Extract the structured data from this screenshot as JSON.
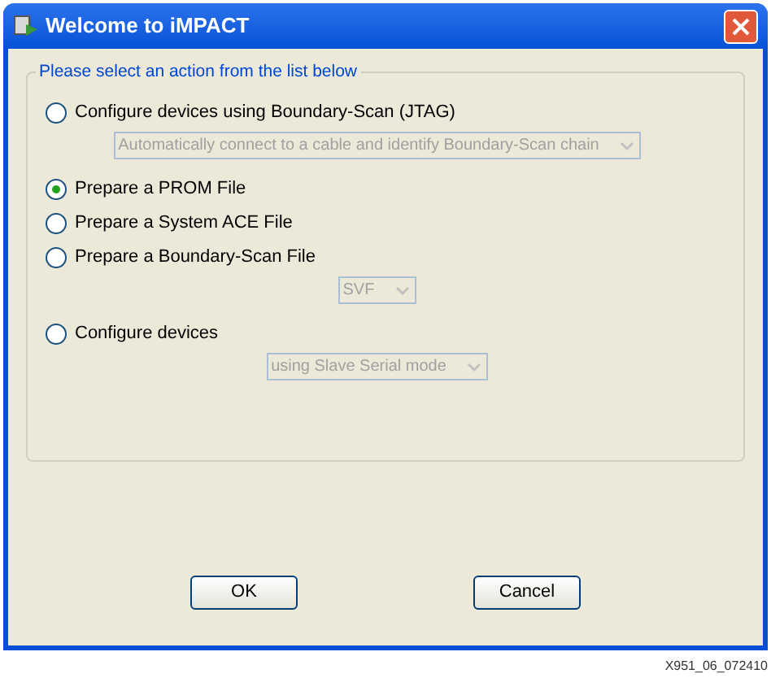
{
  "window": {
    "title": "Welcome to iMPACT"
  },
  "group": {
    "title": "Please select an action from the list below",
    "options": [
      {
        "label": "Configure devices using Boundary-Scan (JTAG)",
        "selected": false,
        "dropdown": {
          "value": "Automatically connect to a cable and identify Boundary-Scan chain",
          "disabled": true
        }
      },
      {
        "label": "Prepare a PROM File",
        "selected": true
      },
      {
        "label": "Prepare a System ACE File",
        "selected": false
      },
      {
        "label": "Prepare a Boundary-Scan File",
        "selected": false,
        "dropdown": {
          "value": "SVF",
          "disabled": true
        }
      },
      {
        "label": "Configure devices",
        "selected": false,
        "dropdown": {
          "value": "using Slave Serial mode",
          "disabled": true
        }
      }
    ]
  },
  "buttons": [
    "OK",
    "Cancel"
  ],
  "figure_id": "X951_06_072410"
}
